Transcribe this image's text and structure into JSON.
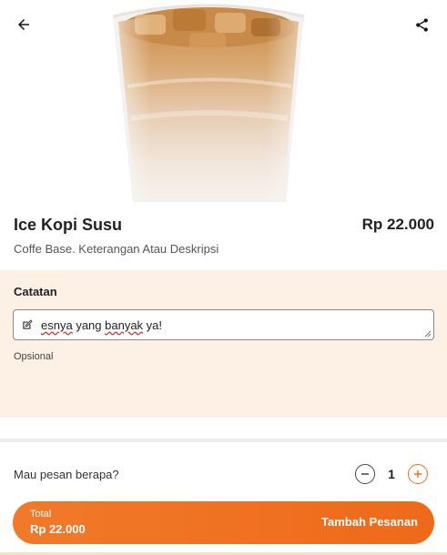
{
  "header": {
    "back_icon": "arrow-left-icon",
    "share_icon": "share-icon"
  },
  "product": {
    "name": "Ice Kopi Susu",
    "price": "Rp 22.000",
    "description": "Coffe Base. Keterangan Atau Deskripsi",
    "image": "iced-coffee-milk-cup"
  },
  "notes": {
    "label": "Catatan",
    "value_part1": "esnya",
    "value_part2": " yang ",
    "value_part3": "banyak",
    "value_part4": " ya!",
    "hint": "Opsional",
    "icon": "edit-icon"
  },
  "quantity": {
    "label": "Mau pesan berapa?",
    "value": "1",
    "minus_icon": "minus-circle-icon",
    "plus_icon": "plus-circle-icon"
  },
  "cta": {
    "total_label": "Total",
    "total_value": "Rp 22.000",
    "action_label": "Tambah Pesanan"
  },
  "colors": {
    "accent": "#f07020",
    "notes_bg": "#fdf1e6"
  }
}
